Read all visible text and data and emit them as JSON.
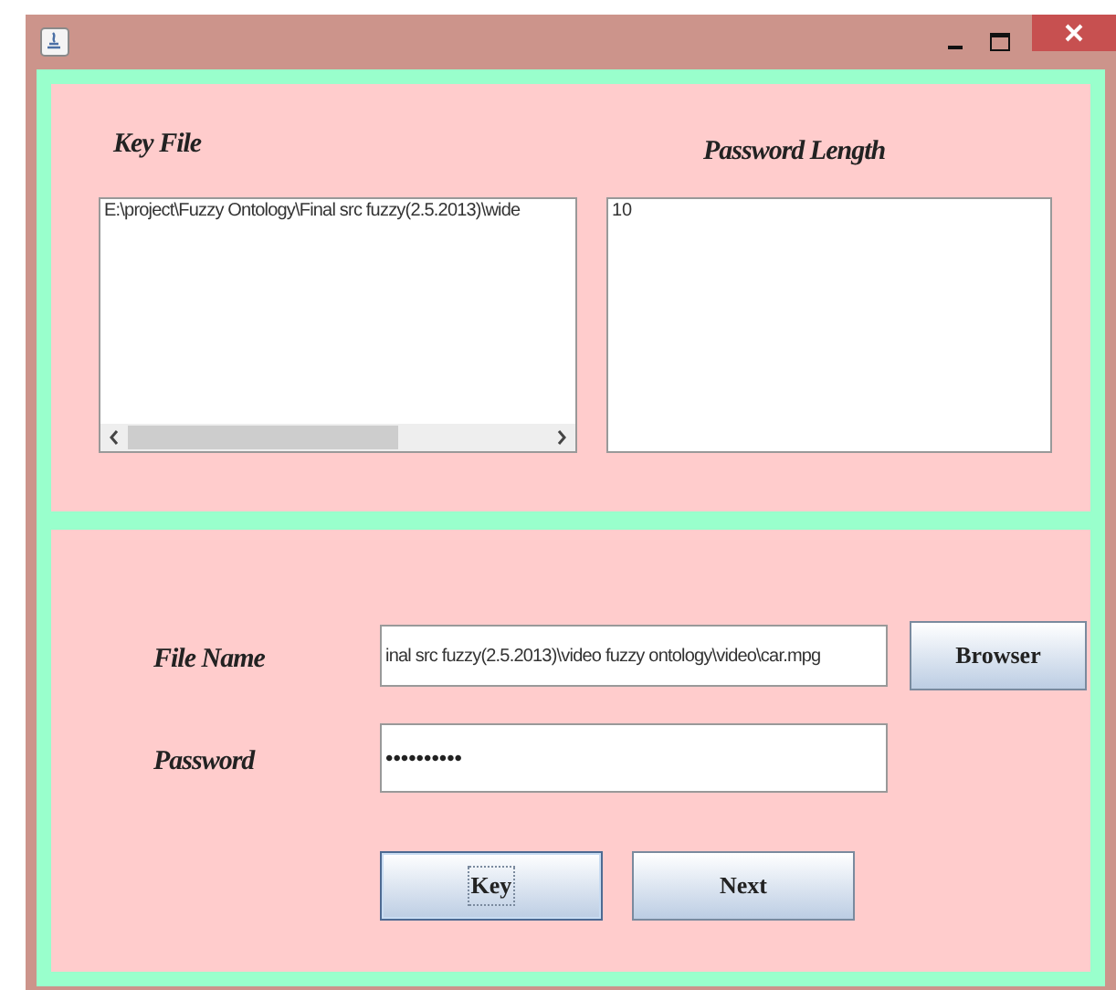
{
  "key_file": {
    "label": "Key File",
    "value": "E:\\project\\Fuzzy Ontology\\Final src fuzzy(2.5.2013)\\wide"
  },
  "password_length": {
    "label": "Password Length",
    "value": "10"
  },
  "file_name": {
    "label": "File Name",
    "value": "inal src fuzzy(2.5.2013)\\video fuzzy ontology\\video\\car.mpg"
  },
  "password": {
    "label": "Password",
    "value": "••••••••••"
  },
  "buttons": [
    {
      "label": "Browser",
      "focused": false
    },
    {
      "label": "Key",
      "focused": true
    },
    {
      "label": "Next",
      "focused": false
    }
  ]
}
